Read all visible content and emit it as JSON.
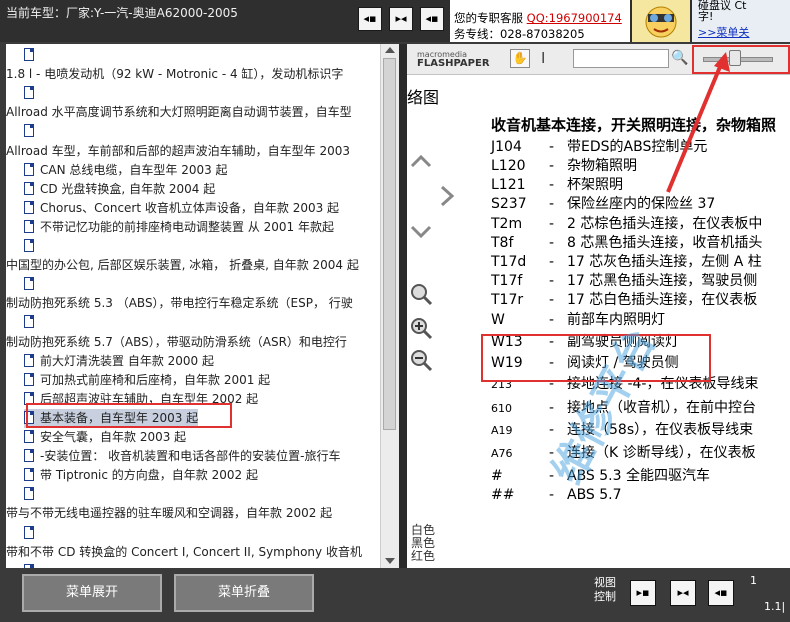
{
  "topbar": {
    "current_model": "当前车型：厂家:Y-一汽-奥迪A62000-2005",
    "view_buttons": [
      "◂▪",
      "▸◂",
      "◂▪"
    ]
  },
  "support": {
    "line1_prefix": "您的专职客服",
    "qq": "QQ:1967900174",
    "line2": "务专线：028-87038205"
  },
  "chat": {
    "line1": "碰盘议  Ct",
    "line2": "字!",
    "menu": ">>菜单关"
  },
  "tree": {
    "items": [
      {
        "text": "",
        "icon": true,
        "indent": 1
      },
      {
        "text": "1.8 l - 电喷发动机（92 kW - Motronic - 4 缸），发动机标识字",
        "icon": false,
        "indent": 0
      },
      {
        "text": "",
        "icon": true,
        "indent": 1
      },
      {
        "text": "Allroad 水平高度调节系统和大灯照明距离自动调节装置，自车型",
        "icon": false,
        "indent": 0
      },
      {
        "text": "",
        "icon": true,
        "indent": 1
      },
      {
        "text": "Allroad 车型，车前部和后部的超声波泊车辅助，自车型年 2003",
        "icon": false,
        "indent": 0
      },
      {
        "text": "CAN 总线电缆，自车型年 2003 起",
        "icon": true,
        "indent": 1
      },
      {
        "text": "CD 光盘转换盒, 自年款 2004 起",
        "icon": true,
        "indent": 1
      },
      {
        "text": "Chorus、Concert 收音机立体声设备，自年款 2003 起",
        "icon": true,
        "indent": 1
      },
      {
        "text": "不带记忆功能的前排座椅电动调整装置 从 2001 年款起",
        "icon": true,
        "indent": 1
      },
      {
        "text": "",
        "icon": true,
        "indent": 1
      },
      {
        "text": "中国型的办公包, 后部区娱乐装置, 冰箱， 折叠桌, 自年款 2004 起",
        "icon": false,
        "indent": 0
      },
      {
        "text": "",
        "icon": true,
        "indent": 1
      },
      {
        "text": "制动防抱死系统 5.3 （ABS），带电控行车稳定系统（ESP， 行驶",
        "icon": false,
        "indent": 0
      },
      {
        "text": "",
        "icon": true,
        "indent": 1
      },
      {
        "text": "制动防抱死系统 5.7（ABS），带驱动防滑系统（ASR）和电控行",
        "icon": false,
        "indent": 0
      },
      {
        "text": "前大灯清洗装置 自年款 2000 起",
        "icon": true,
        "indent": 1
      },
      {
        "text": "可加热式前座椅和后座椅，自年款 2001 起",
        "icon": true,
        "indent": 1
      },
      {
        "text": "后部超声波驻车辅助，自车型年 2002 起",
        "icon": true,
        "indent": 1
      },
      {
        "text": "基本装备，自车型年 2003 起",
        "icon": true,
        "indent": 1,
        "selected": true
      },
      {
        "text": "安全气囊，自年款 2003 起",
        "icon": true,
        "indent": 1
      },
      {
        "text": "-安装位置： 收音机装置和电话各部件的安装位置-旅行车",
        "icon": true,
        "indent": 1
      },
      {
        "text": "带 Tiptronic 的方向盘，自年款 2002 起",
        "icon": true,
        "indent": 1
      },
      {
        "text": "",
        "icon": true,
        "indent": 1
      },
      {
        "text": "带与不带无线电遥控器的驻车暖风和空调器，自年款 2002 起",
        "icon": false,
        "indent": 0
      },
      {
        "text": "",
        "icon": true,
        "indent": 1
      },
      {
        "text": "带和不带 CD 转换盒的 Concert I, Concert II, Symphony 收音机",
        "icon": false,
        "indent": 0
      },
      {
        "text": "",
        "icon": true,
        "indent": 1
      }
    ]
  },
  "viewer": {
    "logo_small": "macromedia",
    "logo_big": "FLASHPAPER",
    "page_heading_fragment": "络图",
    "title": "收音机基本连接，开关照明连接，杂物箱照",
    "legend": [
      {
        "code": "J104",
        "desc": "带EDS的ABS控制单元"
      },
      {
        "code": "L120",
        "desc": "杂物箱照明"
      },
      {
        "code": "L121",
        "desc": "杯架照明"
      },
      {
        "code": "S237",
        "desc": "保险丝座内的保险丝 37"
      },
      {
        "code": "T2m",
        "desc": "2 芯棕色插头连接，在仪表板中"
      },
      {
        "code": "T8f",
        "desc": "8 芯黑色插头连接，收音机插头"
      },
      {
        "code": "T17d",
        "desc": "17 芯灰色插头连接，左侧 A 柱"
      },
      {
        "code": "T17f",
        "desc": "17 芯黑色插头连接，驾驶员侧"
      },
      {
        "code": "T17r",
        "desc": "17 芯白色插头连接，在仪表板"
      },
      {
        "code": "W",
        "desc": "前部车内照明灯"
      },
      {
        "code": "W13",
        "desc": "副驾驶员侧阅读灯"
      },
      {
        "code": "W19",
        "desc": "阅读灯 / 驾驶员侧"
      },
      {
        "code": "213",
        "desc": "接地连接 -4-，在仪表板导线束"
      },
      {
        "code": "610",
        "desc": "接地点（收音机），在前中控台"
      },
      {
        "code": "A19",
        "desc": "连接（58s），在仪表板导线束"
      },
      {
        "code": "A76",
        "desc": "连接（K 诊断导线），在仪表板"
      },
      {
        "code": "#",
        "desc": "ABS 5.3 全能四驱汽车"
      },
      {
        "code": "##",
        "desc": "ABS 5.7"
      }
    ],
    "side_colors": [
      "白色",
      "黑色",
      "红色"
    ],
    "watermark": "维修平台"
  },
  "bottombar": {
    "expand_label": "菜单展开",
    "collapse_label": "菜单折叠",
    "view_control_l1": "视图",
    "view_control_l2": "控制",
    "page_num": "1",
    "page_total": "1.1|"
  }
}
